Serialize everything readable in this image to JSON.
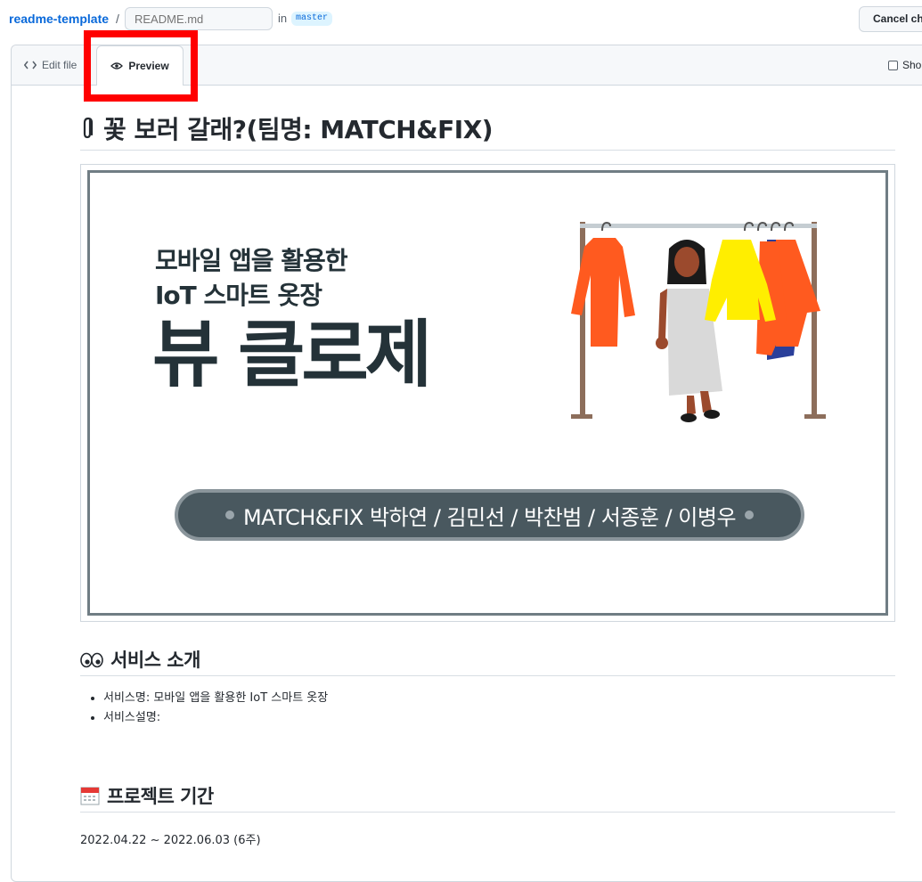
{
  "header": {
    "repo": "readme-template",
    "separator": "/",
    "filename_placeholder": "README.md",
    "in_label": "in",
    "branch": "master",
    "cancel_label": "Cancel ch"
  },
  "tabs": {
    "edit_label": "Edit file",
    "preview_label": "Preview",
    "show_diff_label": "Sho"
  },
  "preview": {
    "title": "꽃 보러 갈래?(팀명: MATCH&FIX)",
    "banner": {
      "subtitle_line1": "모바일 앱을 활용한",
      "subtitle_line2": "IoT 스마트 옷장",
      "big_title": "뷰 클로제",
      "team_line": "MATCH&FIX 박하연 / 김민선 / 박찬범 / 서종훈 / 이병우"
    },
    "section_service": {
      "heading": "서비스 소개",
      "items": [
        "서비스명: 모바일 앱을 활용한 IoT 스마트 옷장",
        "서비스설명:"
      ]
    },
    "section_period": {
      "heading": "프로젝트 기간",
      "text": "2022.04.22 ~ 2022.06.03 (6주)"
    }
  },
  "colors": {
    "link": "#0969da",
    "highlight": "#ff0000",
    "banner_text": "#243238",
    "pill_bg": "#49585f"
  },
  "icons": [
    "code-icon",
    "eye-icon",
    "paperclip-icon",
    "eyes-icon",
    "calendar-icon",
    "checkbox-icon"
  ]
}
